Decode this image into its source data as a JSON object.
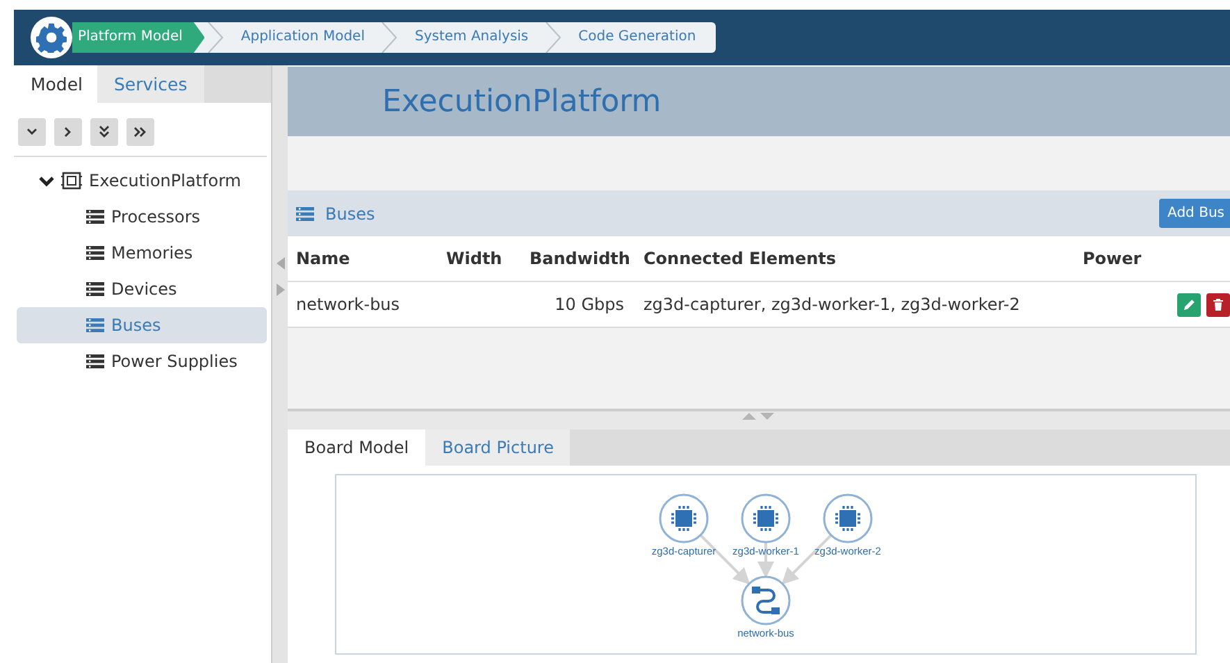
{
  "steps": [
    {
      "label": "Platform Model",
      "selected": true
    },
    {
      "label": "Application Model",
      "selected": false
    },
    {
      "label": "System Analysis",
      "selected": false
    },
    {
      "label": "Code Generation",
      "selected": false
    }
  ],
  "sidebar": {
    "tabs": [
      {
        "label": "Model",
        "selected": true
      },
      {
        "label": "Services",
        "selected": false
      }
    ],
    "tree": [
      {
        "label": "ExecutionPlatform",
        "kind": "platform",
        "expanded": true,
        "selected": false,
        "children": [
          {
            "label": "Processors",
            "kind": "list",
            "selected": false
          },
          {
            "label": "Memories",
            "kind": "list",
            "selected": false
          },
          {
            "label": "Devices",
            "kind": "list",
            "selected": false
          },
          {
            "label": "Buses",
            "kind": "list",
            "selected": true
          },
          {
            "label": "Power Supplies",
            "kind": "list",
            "selected": false
          }
        ]
      }
    ]
  },
  "title": "ExecutionPlatform",
  "section": {
    "title": "Buses",
    "add_button": "Add Bus",
    "columns": [
      "Name",
      "Width",
      "Bandwidth",
      "Connected Elements",
      "Power"
    ],
    "rows": [
      {
        "cells": [
          "network-bus",
          "",
          "10 Gbps",
          "zg3d-capturer, zg3d-worker-1, zg3d-worker-2",
          ""
        ]
      }
    ]
  },
  "bottom_tabs": [
    {
      "label": "Board Model",
      "selected": true
    },
    {
      "label": "Board Picture",
      "selected": false
    }
  ],
  "diagram": {
    "nodes": [
      {
        "label": "zg3d-capturer",
        "kind": "processor"
      },
      {
        "label": "zg3d-worker-1",
        "kind": "processor"
      },
      {
        "label": "zg3d-worker-2",
        "kind": "processor"
      },
      {
        "label": "network-bus",
        "kind": "bus"
      }
    ]
  }
}
